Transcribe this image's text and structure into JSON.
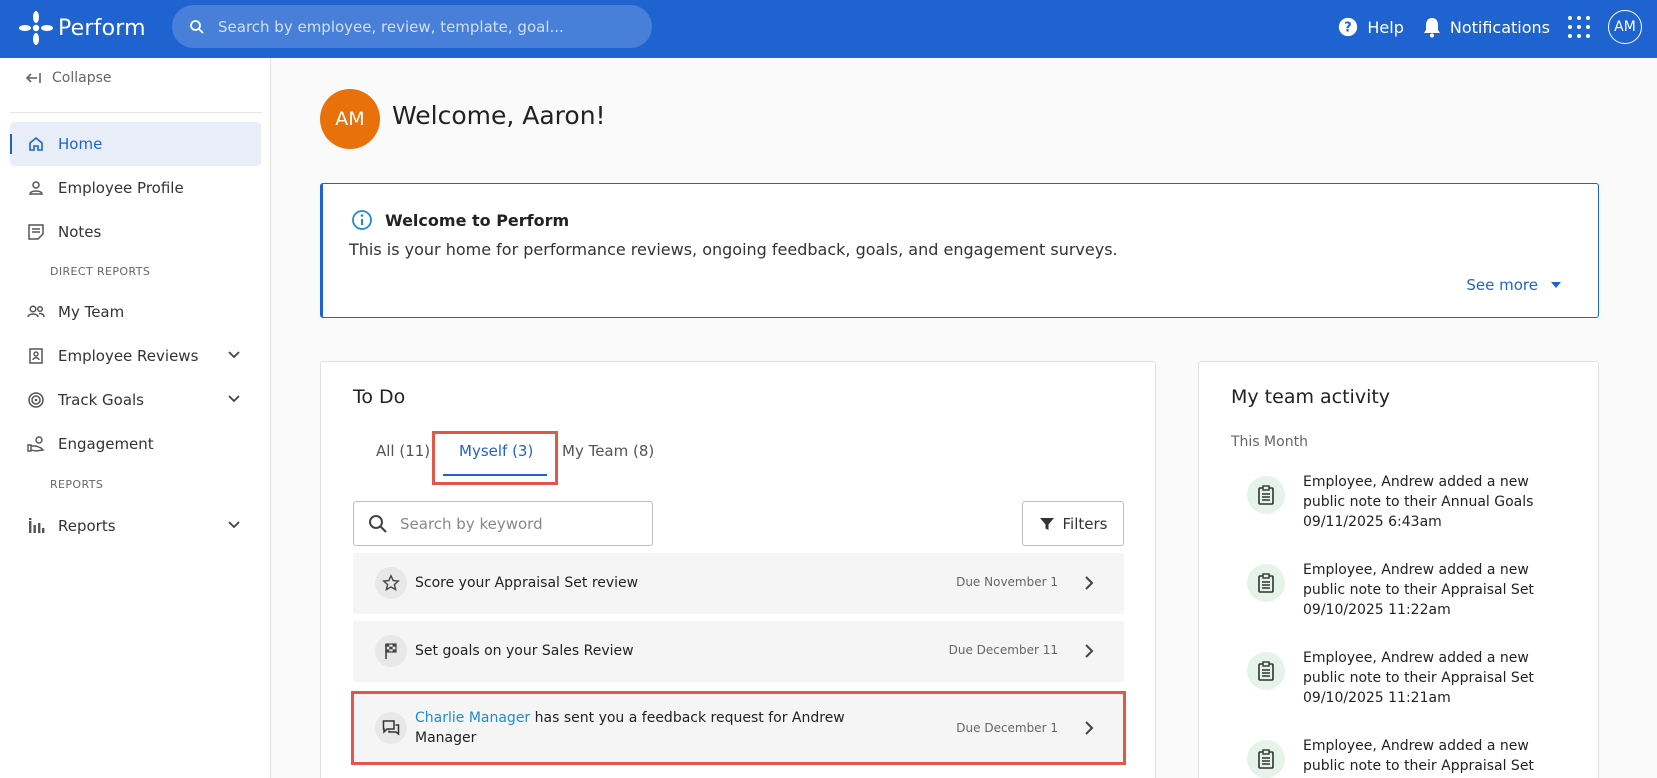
{
  "header": {
    "app_name": "Perform",
    "search_placeholder": "Search by employee, review, template, goal...",
    "help_label": "Help",
    "notifications_label": "Notifications",
    "user_initials": "AM"
  },
  "sidebar": {
    "collapse_label": "Collapse",
    "items": [
      {
        "label": "Home",
        "icon": "home-icon",
        "active": true
      },
      {
        "label": "Employee Profile",
        "icon": "person-icon"
      },
      {
        "label": "Notes",
        "icon": "note-icon"
      },
      {
        "label": "My Team",
        "icon": "team-icon"
      },
      {
        "label": "Employee Reviews",
        "icon": "review-icon",
        "expandable": true
      },
      {
        "label": "Track Goals",
        "icon": "target-icon",
        "expandable": true
      },
      {
        "label": "Engagement",
        "icon": "engagement-icon"
      },
      {
        "label": "Reports",
        "icon": "bar-chart-icon",
        "expandable": true
      }
    ],
    "section_direct_reports": "DIRECT REPORTS",
    "section_reports": "REPORTS"
  },
  "welcome": {
    "initials": "AM",
    "title": "Welcome, Aaron!"
  },
  "banner": {
    "title": "Welcome to Perform",
    "body": "This is your home for performance reviews, ongoing feedback, goals, and engagement surveys.",
    "see_more": "See more"
  },
  "todo": {
    "title": "To Do",
    "tabs": [
      {
        "label": "All (11)"
      },
      {
        "label": "Myself (3)",
        "selected": true
      },
      {
        "label": "My Team (8)"
      }
    ],
    "search_placeholder": "Search by keyword",
    "filters_label": "Filters",
    "items": [
      {
        "icon": "star-icon",
        "text": "Score your Appraisal Set review",
        "due": "Due November 1"
      },
      {
        "icon": "flag-icon",
        "text": "Set goals on your Sales Review",
        "due": "Due December 11"
      },
      {
        "icon": "chat-icon",
        "link": "Charlie Manager",
        "text": " has sent you a feedback request for Andrew",
        "text2": "Manager",
        "due": "Due December 1"
      }
    ]
  },
  "team_activity": {
    "title": "My team activity",
    "period": "This Month",
    "items": [
      {
        "line1": "Employee, Andrew added a new",
        "line2": "public note to their Annual Goals",
        "time": "09/11/2025 6:43am"
      },
      {
        "line1": "Employee, Andrew added a new",
        "line2": "public note to their Appraisal Set",
        "time": "09/10/2025 11:22am"
      },
      {
        "line1": "Employee, Andrew added a new",
        "line2": "public note to their Appraisal Set",
        "time": "09/10/2025 11:21am"
      },
      {
        "line1": "Employee, Andrew added a new",
        "line2": "public note to their Appraisal Set",
        "time": ""
      }
    ]
  },
  "colors": {
    "brand_blue": "#1f63d1",
    "avatar_orange": "#e8710a",
    "highlight_red": "#e1574b",
    "link_blue": "#1f8ad6"
  }
}
